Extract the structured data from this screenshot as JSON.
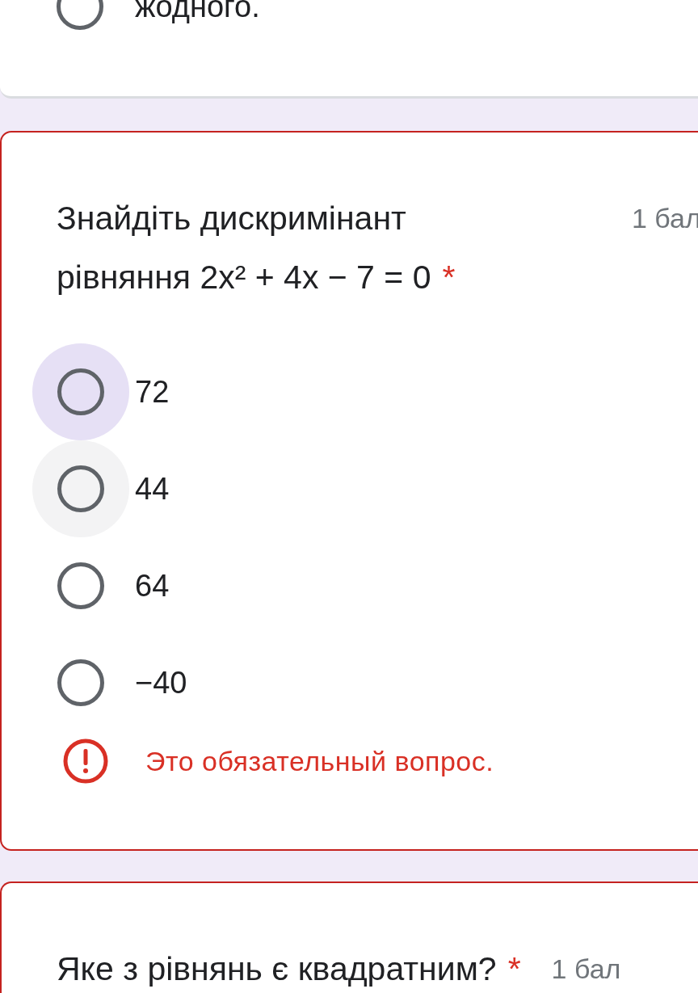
{
  "previous_question": {
    "options": [
      {
        "label": "жодного.",
        "selected": false
      }
    ]
  },
  "question": {
    "title": "Знайдіть дискримінант рівняння 2x² + 4x − 7 = 0",
    "required_mark": "*",
    "points": "1 бал",
    "has_error": true,
    "options": [
      {
        "label": "72",
        "selected": false,
        "focused": true,
        "hovered": false
      },
      {
        "label": "44",
        "selected": false,
        "focused": false,
        "hovered": true
      },
      {
        "label": "64",
        "selected": false,
        "focused": false,
        "hovered": false
      },
      {
        "label": "−40",
        "selected": false,
        "focused": false,
        "hovered": false
      }
    ],
    "error": "Это обязательный вопрос."
  },
  "next_question": {
    "title": "Яке з рівнянь є квадратним?",
    "required_mark": "*",
    "points": "1 бал",
    "has_error": true
  }
}
